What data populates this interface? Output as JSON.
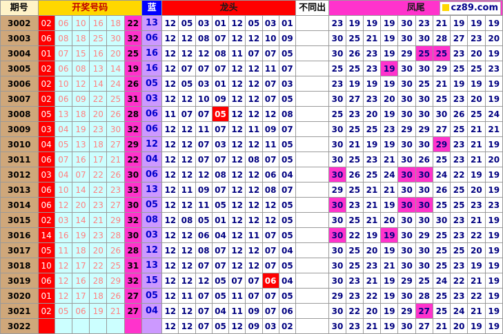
{
  "headers": {
    "period": "期号",
    "draw": "开奖号码",
    "blue": "蓝",
    "long": "龙头",
    "diff": "不同出",
    "tail": "凤尾",
    "logo": "cz89.com"
  },
  "rows": [
    {
      "period": "3002",
      "draw": [
        "02",
        "06",
        "10",
        "16",
        "18",
        "22"
      ],
      "blue": "13",
      "long": [
        "12",
        "05",
        "03",
        "01",
        "12",
        "05",
        "03",
        "01"
      ],
      "tail": [
        "23",
        "19",
        "19",
        "19",
        "30",
        "23",
        "21",
        "19",
        "19",
        "19"
      ]
    },
    {
      "period": "3003",
      "draw": [
        "06",
        "08",
        "18",
        "25",
        "30",
        "32"
      ],
      "blue": "06",
      "long": [
        "12",
        "12",
        "08",
        "07",
        "12",
        "12",
        "10",
        "09"
      ],
      "tail": [
        "30",
        "25",
        "21",
        "19",
        "30",
        "30",
        "28",
        "27",
        "23",
        "20"
      ]
    },
    {
      "period": "3004",
      "draw": [
        "01",
        "07",
        "15",
        "16",
        "20",
        "25"
      ],
      "blue": "16",
      "long": [
        "12",
        "12",
        "12",
        "08",
        "11",
        "07",
        "07",
        "05"
      ],
      "tail": [
        "30",
        "26",
        "23",
        "19",
        "29",
        "25",
        "25",
        "23",
        "20",
        "19"
      ]
    },
    {
      "period": "3005",
      "draw": [
        "02",
        "06",
        "08",
        "13",
        "14",
        "19"
      ],
      "blue": "16",
      "long": [
        "12",
        "07",
        "07",
        "07",
        "12",
        "12",
        "11",
        "07"
      ],
      "tail": [
        "25",
        "25",
        "23",
        "19",
        "30",
        "30",
        "29",
        "25",
        "25",
        "23"
      ]
    },
    {
      "period": "3006",
      "draw": [
        "02",
        "10",
        "12",
        "14",
        "24",
        "26"
      ],
      "blue": "05",
      "long": [
        "12",
        "05",
        "03",
        "01",
        "12",
        "12",
        "07",
        "03"
      ],
      "tail": [
        "23",
        "19",
        "19",
        "19",
        "30",
        "25",
        "21",
        "19",
        "19",
        "19"
      ]
    },
    {
      "period": "3007",
      "draw": [
        "02",
        "06",
        "09",
        "22",
        "25",
        "31"
      ],
      "blue": "03",
      "long": [
        "12",
        "12",
        "10",
        "09",
        "12",
        "12",
        "07",
        "05"
      ],
      "tail": [
        "30",
        "27",
        "23",
        "20",
        "30",
        "30",
        "25",
        "23",
        "20",
        "19"
      ]
    },
    {
      "period": "3008",
      "draw": [
        "05",
        "13",
        "18",
        "20",
        "26",
        "28"
      ],
      "blue": "06",
      "long": [
        "11",
        "07",
        "07",
        "05",
        "12",
        "12",
        "12",
        "08"
      ],
      "tail": [
        "25",
        "23",
        "20",
        "19",
        "30",
        "30",
        "30",
        "26",
        "25",
        "24"
      ]
    },
    {
      "period": "3009",
      "draw": [
        "03",
        "04",
        "19",
        "23",
        "30",
        "32"
      ],
      "blue": "06",
      "long": [
        "12",
        "12",
        "11",
        "07",
        "12",
        "11",
        "09",
        "07"
      ],
      "tail": [
        "30",
        "25",
        "25",
        "23",
        "29",
        "29",
        "27",
        "25",
        "21",
        "21"
      ]
    },
    {
      "period": "3010",
      "draw": [
        "04",
        "05",
        "13",
        "18",
        "27",
        "29"
      ],
      "blue": "12",
      "long": [
        "12",
        "12",
        "07",
        "03",
        "12",
        "12",
        "11",
        "05"
      ],
      "tail": [
        "30",
        "21",
        "19",
        "19",
        "30",
        "30",
        "29",
        "23",
        "21",
        "19"
      ]
    },
    {
      "period": "3011",
      "draw": [
        "06",
        "07",
        "16",
        "17",
        "21",
        "22"
      ],
      "blue": "04",
      "long": [
        "12",
        "12",
        "07",
        "07",
        "12",
        "08",
        "07",
        "05"
      ],
      "tail": [
        "30",
        "25",
        "23",
        "21",
        "30",
        "26",
        "25",
        "23",
        "21",
        "20"
      ]
    },
    {
      "period": "3012",
      "draw": [
        "03",
        "04",
        "07",
        "22",
        "26",
        "30"
      ],
      "blue": "06",
      "long": [
        "12",
        "12",
        "12",
        "08",
        "12",
        "12",
        "06",
        "04"
      ],
      "tail": [
        "30",
        "26",
        "25",
        "24",
        "30",
        "30",
        "24",
        "22",
        "19",
        "19"
      ]
    },
    {
      "period": "3013",
      "draw": [
        "06",
        "10",
        "14",
        "22",
        "23",
        "33"
      ],
      "blue": "13",
      "long": [
        "12",
        "11",
        "09",
        "07",
        "12",
        "12",
        "08",
        "07"
      ],
      "tail": [
        "29",
        "25",
        "21",
        "21",
        "30",
        "30",
        "26",
        "25",
        "20",
        "19"
      ]
    },
    {
      "period": "3014",
      "draw": [
        "06",
        "12",
        "20",
        "23",
        "27",
        "30"
      ],
      "blue": "05",
      "long": [
        "12",
        "12",
        "11",
        "05",
        "12",
        "12",
        "12",
        "05"
      ],
      "tail": [
        "30",
        "23",
        "21",
        "19",
        "30",
        "30",
        "25",
        "25",
        "23",
        "23"
      ]
    },
    {
      "period": "3015",
      "draw": [
        "02",
        "03",
        "14",
        "21",
        "29",
        "32"
      ],
      "blue": "08",
      "long": [
        "12",
        "08",
        "05",
        "01",
        "12",
        "12",
        "12",
        "05"
      ],
      "tail": [
        "30",
        "25",
        "21",
        "20",
        "30",
        "30",
        "30",
        "23",
        "21",
        "19"
      ]
    },
    {
      "period": "3016",
      "draw": [
        "14",
        "16",
        "19",
        "23",
        "28",
        "30"
      ],
      "blue": "03",
      "long": [
        "12",
        "12",
        "06",
        "04",
        "12",
        "11",
        "07",
        "05"
      ],
      "tail": [
        "30",
        "22",
        "19",
        "19",
        "30",
        "29",
        "25",
        "23",
        "22",
        "19"
      ]
    },
    {
      "period": "3017",
      "draw": [
        "05",
        "11",
        "18",
        "20",
        "26",
        "28"
      ],
      "blue": "12",
      "long": [
        "12",
        "12",
        "08",
        "07",
        "12",
        "12",
        "07",
        "04"
      ],
      "tail": [
        "30",
        "25",
        "20",
        "19",
        "30",
        "30",
        "25",
        "25",
        "20",
        "19"
      ]
    },
    {
      "period": "3018",
      "draw": [
        "10",
        "12",
        "17",
        "22",
        "25",
        "31"
      ],
      "blue": "13",
      "long": [
        "12",
        "12",
        "07",
        "07",
        "12",
        "12",
        "07",
        "05"
      ],
      "tail": [
        "30",
        "25",
        "23",
        "21",
        "30",
        "30",
        "25",
        "23",
        "19",
        "19"
      ]
    },
    {
      "period": "3019",
      "draw": [
        "06",
        "12",
        "16",
        "28",
        "29",
        "32"
      ],
      "blue": "15",
      "long": [
        "12",
        "12",
        "12",
        "05",
        "07",
        "07",
        "06",
        "04"
      ],
      "tail": [
        "30",
        "23",
        "21",
        "19",
        "29",
        "25",
        "24",
        "22",
        "21",
        "19"
      ]
    },
    {
      "period": "3020",
      "draw": [
        "01",
        "12",
        "17",
        "18",
        "26",
        "27"
      ],
      "blue": "05",
      "long": [
        "12",
        "11",
        "07",
        "05",
        "11",
        "07",
        "07",
        "05"
      ],
      "tail": [
        "29",
        "23",
        "22",
        "19",
        "30",
        "28",
        "25",
        "23",
        "22",
        "19"
      ]
    },
    {
      "period": "3021",
      "draw": [
        "02",
        "05",
        "06",
        "19",
        "21",
        "27"
      ],
      "blue": "04",
      "long": [
        "12",
        "12",
        "07",
        "04",
        "11",
        "09",
        "07",
        "06"
      ],
      "tail": [
        "30",
        "22",
        "20",
        "19",
        "29",
        "27",
        "25",
        "24",
        "21",
        "19"
      ]
    },
    {
      "period": "3022",
      "draw": [
        "",
        "",
        "",
        "",
        "",
        ""
      ],
      "blue": "",
      "long": [
        "12",
        "12",
        "07",
        "05",
        "12",
        "09",
        "03",
        "02"
      ],
      "tail": [
        "30",
        "23",
        "21",
        "19",
        "30",
        "27",
        "21",
        "20",
        "19",
        "19"
      ]
    }
  ],
  "highlights": {
    "long_red": [
      {
        "row": 6,
        "col": 3
      },
      {
        "row": 17,
        "col": 6
      }
    ],
    "tail_magenta": [
      {
        "row": 2,
        "col": 5
      },
      {
        "row": 2,
        "col": 6
      },
      {
        "row": 3,
        "col": 3
      },
      {
        "row": 8,
        "col": 6
      },
      {
        "row": 10,
        "col": 0
      },
      {
        "row": 10,
        "col": 4
      },
      {
        "row": 10,
        "col": 5
      },
      {
        "row": 12,
        "col": 0
      },
      {
        "row": 12,
        "col": 4
      },
      {
        "row": 12,
        "col": 5
      },
      {
        "row": 14,
        "col": 0
      },
      {
        "row": 14,
        "col": 3
      },
      {
        "row": 19,
        "col": 5
      }
    ]
  }
}
